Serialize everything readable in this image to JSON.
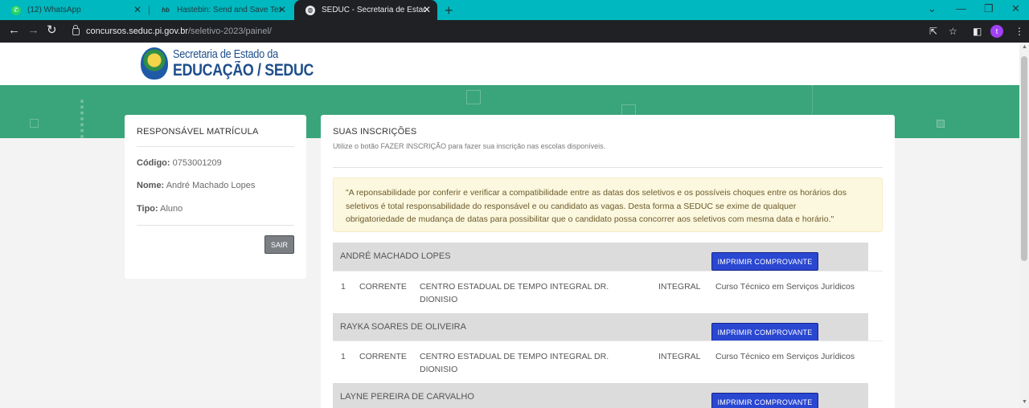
{
  "browser": {
    "tabs": [
      {
        "title": "(12) WhatsApp",
        "icon": "whatsapp-icon"
      },
      {
        "title": "Hastebin: Send and Save Text or",
        "icon": "hastebin-icon"
      },
      {
        "title": "SEDUC - Secretaria de Estado da",
        "icon": "globe-icon"
      }
    ],
    "url_host": "concursos.seduc.pi.gov.br",
    "url_path": "/seletivo-2023/painel/",
    "profile_initial": "t"
  },
  "header": {
    "logo_line1": "Secretaria de Estado da",
    "logo_line2": "EDUCAÇÃO / SEDUC"
  },
  "responsavel": {
    "title": "RESPONSÁVEL MATRÍCULA",
    "codigo_label": "Código:",
    "codigo_value": "0753001209",
    "nome_label": "Nome:",
    "nome_value": "André Machado Lopes",
    "tipo_label": "Tipo:",
    "tipo_value": "Aluno",
    "logout_label": "SAIR"
  },
  "inscricoes": {
    "title": "SUAS INSCRIÇÕES",
    "subtitle": "Utilize o botão FAZER INSCRIÇÃO para fazer sua inscrição nas escolas disponíveis.",
    "notice_line1": "\"A reponsabilidade por conferir e verificar a compatibilidade entre as datas dos seletivos e os possíveis choques entre os horários dos",
    "notice_line2": "seletivos é total responsabilidade do responsável e ou candidato as vagas. Desta forma a SEDUC se exime de qualquer",
    "notice_line3": "obrigatoriedade de mudança de datas para possibilitar que o candidato possa concorrer aos seletivos com mesma data e horário.\"",
    "print_label": "IMPRIMIR COMPROVANTE",
    "groups": [
      {
        "name": "ANDRÉ MACHADO LOPES",
        "row": {
          "num": "1",
          "city": "CORRENTE",
          "school_l1": "CENTRO ESTADUAL DE TEMPO INTEGRAL DR.",
          "school_l2": "DIONISIO",
          "mode": "INTEGRAL",
          "course": "Curso Técnico em Serviços Jurídicos"
        }
      },
      {
        "name": "RAYKA SOARES DE OLIVEIRA",
        "row": {
          "num": "1",
          "city": "CORRENTE",
          "school_l1": "CENTRO ESTADUAL DE TEMPO INTEGRAL DR.",
          "school_l2": "DIONISIO",
          "mode": "INTEGRAL",
          "course": "Curso Técnico em Serviços Jurídicos"
        }
      },
      {
        "name": "LAYNE PEREIRA DE CARVALHO"
      }
    ]
  }
}
